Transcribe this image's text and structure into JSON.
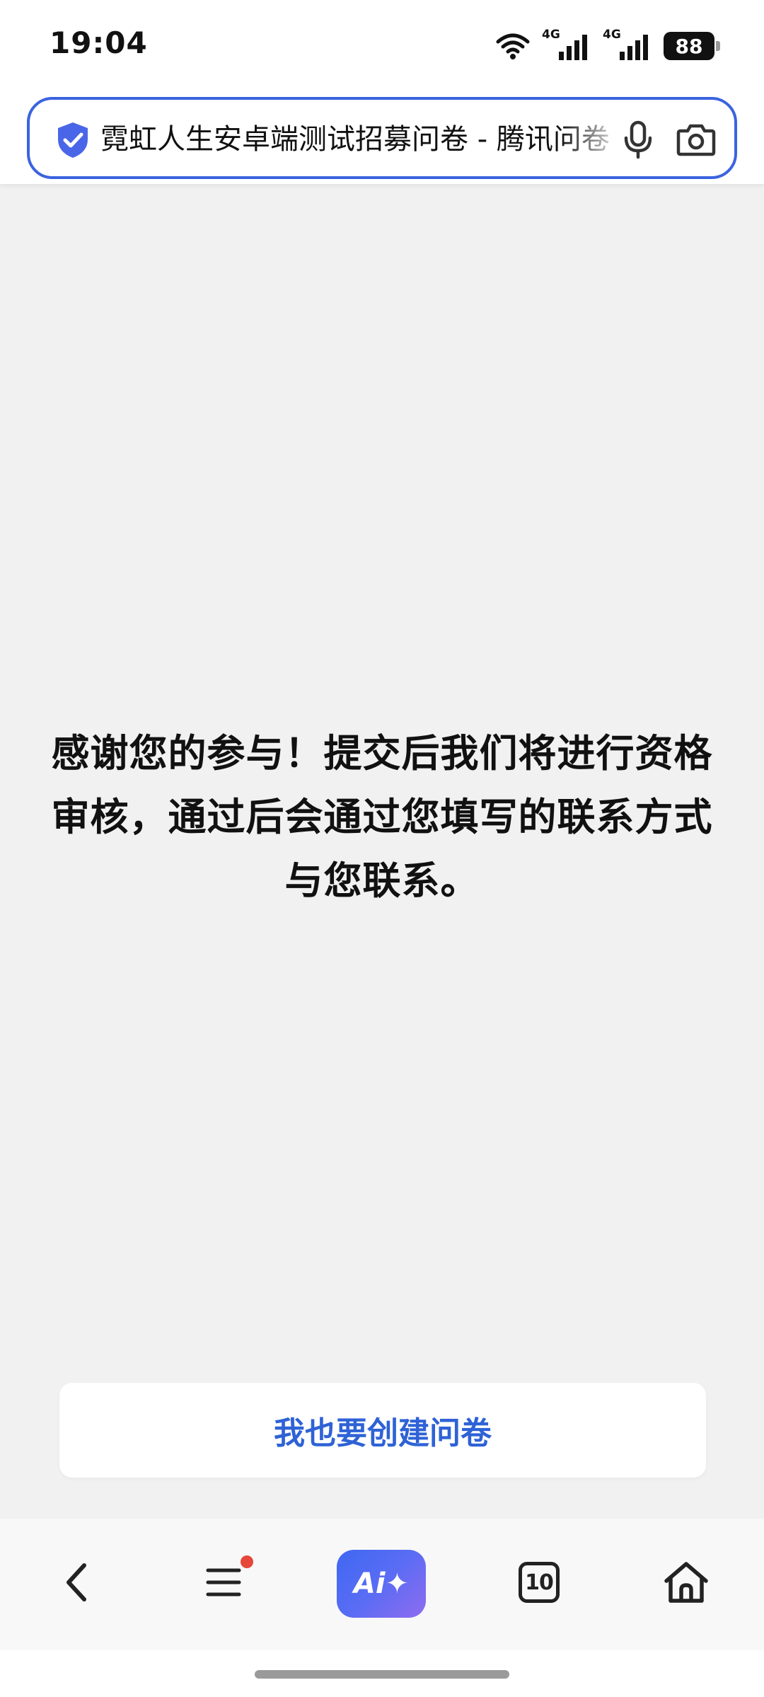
{
  "status_bar": {
    "time": "19:04",
    "network_label_1": "4G",
    "network_label_2": "4G",
    "battery": "88"
  },
  "address_bar": {
    "title": "霓虹人生安卓端测试招募问卷 - 腾讯问卷",
    "accent_color": "#3b63e0",
    "icons": [
      "shield-check-icon",
      "microphone-icon",
      "camera-icon"
    ]
  },
  "main": {
    "message": "感谢您的参与！提交后我们将进行资格审核，通过后会通过您填写的联系方式与您联系。"
  },
  "actions": {
    "create_button": "我也要创建问卷",
    "button_color": "#2e62d6"
  },
  "bottom_nav": {
    "ai_label": "Ai✦",
    "tabs_count": "10",
    "icons": [
      "back-icon",
      "menu-icon",
      "ai-assistant-icon",
      "tabs-icon",
      "home-icon"
    ]
  }
}
